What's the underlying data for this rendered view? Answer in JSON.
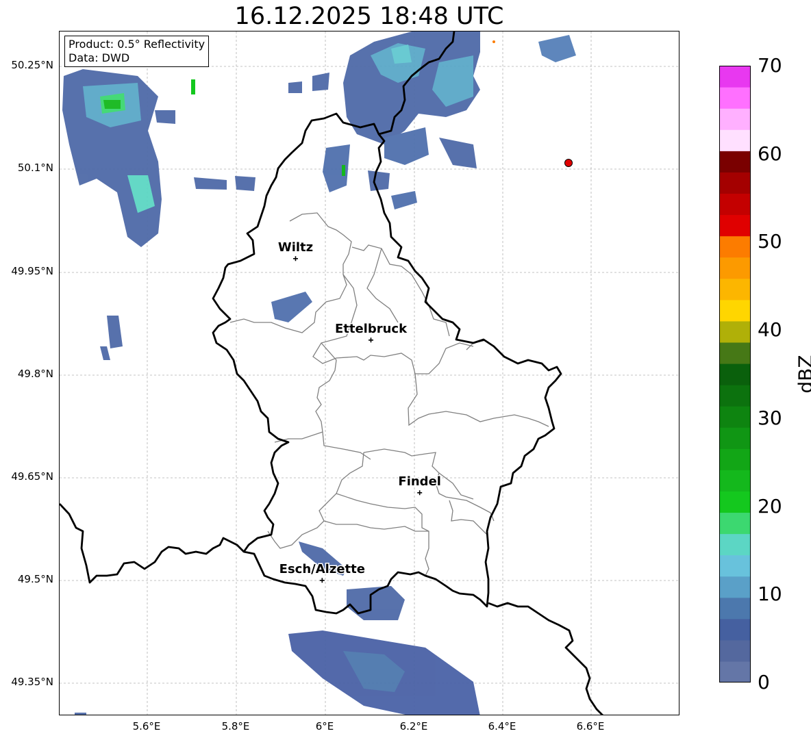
{
  "title": "16.12.2025 18:48 UTC",
  "infobox": {
    "product": "Product: 0.5° Reflectivity",
    "source": "Data: DWD"
  },
  "lat_labels": [
    "50.25°N",
    "50.1°N",
    "49.95°N",
    "49.8°N",
    "49.65°N",
    "49.5°N",
    "49.35°N"
  ],
  "lon_labels": [
    "5.6°E",
    "5.8°E",
    "6°E",
    "6.2°E",
    "6.4°E",
    "6.6°E"
  ],
  "cities": [
    {
      "name": "Wiltz",
      "lon": 5.93,
      "lat": 49.969
    },
    {
      "name": "Ettelbruck",
      "lon": 6.1,
      "lat": 49.85
    },
    {
      "name": "Findel",
      "lon": 6.21,
      "lat": 49.627
    },
    {
      "name": "Esch/Alzette",
      "lon": 5.99,
      "lat": 49.499
    }
  ],
  "colorbar": {
    "label": "dBZ",
    "ticks": [
      "0",
      "10",
      "20",
      "30",
      "40",
      "50",
      "60",
      "70"
    ],
    "colors": [
      "#6476a7",
      "#54689e",
      "#4560a0",
      "#4c78ad",
      "#5aa0c8",
      "#68c2dc",
      "#5cd6c4",
      "#3cd870",
      "#14c81e",
      "#14b81c",
      "#12a616",
      "#109614",
      "#0e8410",
      "#0c720e",
      "#0a600c",
      "#467816",
      "#b0b008",
      "#ffd600",
      "#fcb600",
      "#fc9a00",
      "#fc7c00",
      "#e00000",
      "#c40000",
      "#a40000",
      "#7a0000",
      "#ffe0ff",
      "#ffb0ff",
      "#ff70ff",
      "#e838f0"
    ]
  },
  "chart_data": {
    "type": "map",
    "extent": {
      "lon_min": 5.4,
      "lon_max": 6.8,
      "lat_min": 49.3,
      "lat_max": 50.3
    },
    "grid": true,
    "colorscale_range_dbz": [
      0,
      70
    ],
    "point_marker": {
      "lon": 6.55,
      "lat": 50.11,
      "color": "#e00000"
    }
  }
}
